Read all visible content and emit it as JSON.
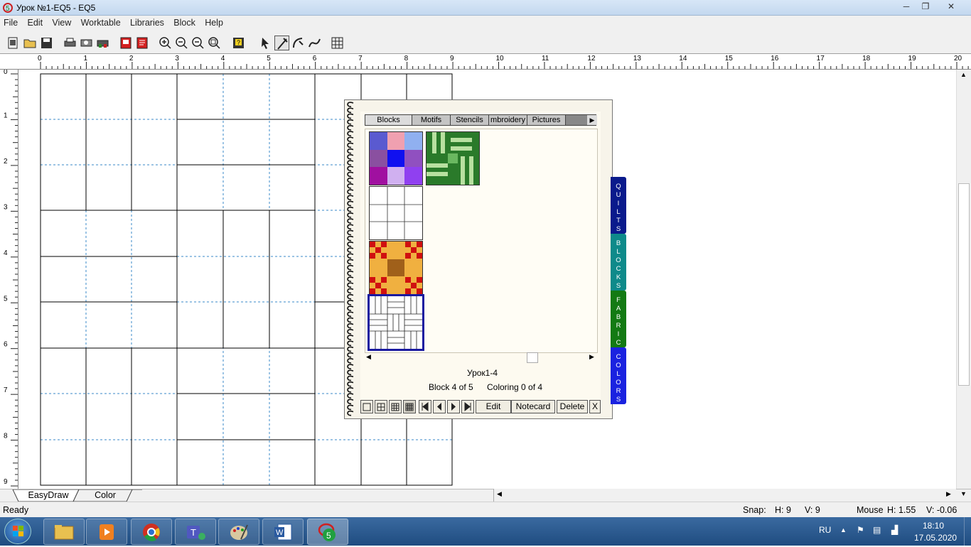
{
  "window": {
    "title": "Урок №1-EQ5 - EQ5",
    "controls": {
      "minimize": "─",
      "maximize": "❐",
      "close": "✕"
    }
  },
  "menu": [
    "File",
    "Edit",
    "View",
    "Worktable",
    "Libraries",
    "Block",
    "Help"
  ],
  "toolbar": {
    "icons": [
      "new-icon",
      "open-icon",
      "save-icon",
      "print-icon",
      "print-preview-icon",
      "print-setup-icon",
      "add-to-sketchbook-icon",
      "view-sketchbook-icon",
      "zoom-in-icon",
      "zoom-out-icon",
      "refresh-icon",
      "fit-to-worktable-icon",
      "help-icon",
      "pick-tool-icon",
      "line-tool-icon",
      "arc-tool-icon",
      "bezier-tool-icon",
      "grid-icon"
    ],
    "selected_tool": "line-tool-icon"
  },
  "ruler": {
    "horizontal": [
      "0",
      "1",
      "2",
      "3",
      "4",
      "5",
      "6",
      "7",
      "8",
      "9",
      "10",
      "11",
      "12",
      "13",
      "14",
      "15",
      "16",
      "17",
      "18",
      "19",
      "20"
    ],
    "vertical": [
      "0",
      "1",
      "2",
      "3",
      "4",
      "5",
      "6",
      "7",
      "8",
      "9"
    ]
  },
  "library": {
    "tabs": [
      "Blocks",
      "Motifs",
      "Stencils",
      "mbroidery",
      "Pictures"
    ],
    "active_tab": "Blocks",
    "block_name": "Урок1-4",
    "block_count": "Block 4 of 5",
    "coloring_count": "Coloring 0 of 4",
    "buttons": {
      "edit": "Edit",
      "notecard": "Notecard",
      "delete": "Delete",
      "close": "X"
    },
    "side_tabs": [
      {
        "label": "QUILTS",
        "color": "#0a1a8c"
      },
      {
        "label": "BLOCKS",
        "color": "#0e8a8a"
      },
      {
        "label": "FABRICS",
        "color": "#137a13"
      },
      {
        "label": "COLORS",
        "color": "#1a22e0"
      }
    ]
  },
  "worktable_tabs": [
    "EasyDraw",
    "Color"
  ],
  "status": {
    "ready": "Ready",
    "snap_label": "Snap:",
    "snap_h": "H:  9",
    "snap_v": "V:  9",
    "mouse_label": "Mouse",
    "mouse_h": "H:  1.55",
    "mouse_v": "V:  -0.06"
  },
  "taskbar": {
    "apps": [
      "explorer-icon",
      "media-player-icon",
      "chrome-icon",
      "teams-icon",
      "paint-icon",
      "word-icon",
      "eq5-icon"
    ],
    "language": "RU",
    "time": "18:10",
    "date": "17.05.2020"
  },
  "colors": {
    "title_bar": "#c9dcf0",
    "taskbar": "#2a5a92",
    "selection_border": "#1a1aa0"
  }
}
